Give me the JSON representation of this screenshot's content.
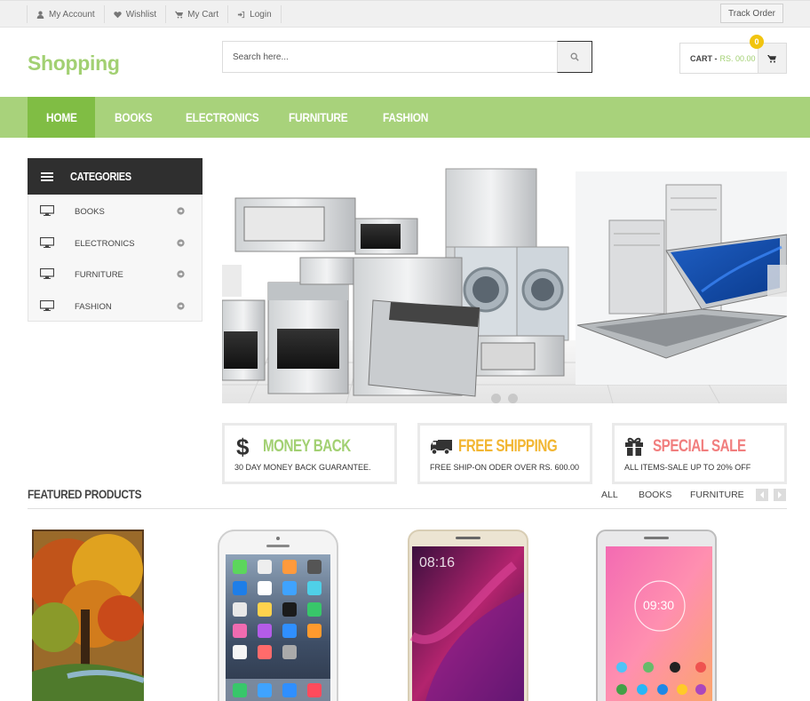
{
  "topbar": {
    "links": [
      {
        "label": "My Account",
        "icon": "user-icon"
      },
      {
        "label": "Wishlist",
        "icon": "heart-icon"
      },
      {
        "label": "My Cart",
        "icon": "cart-icon"
      },
      {
        "label": "Login",
        "icon": "login-icon"
      }
    ],
    "track_order": "Track Order"
  },
  "header": {
    "logo": "Shopping",
    "search_placeholder": "Search here...",
    "cart_label": "CART -",
    "cart_amount": "RS. 00.00",
    "cart_count": "0"
  },
  "nav": {
    "items": [
      "HOME",
      "BOOKS",
      "ELECTRONICS",
      "FURNITURE",
      "FASHION"
    ],
    "active": "HOME"
  },
  "categories": {
    "title": "CATEGORIES",
    "items": [
      "BOOKS",
      "ELECTRONICS",
      "FURNITURE",
      "FASHION"
    ]
  },
  "promos": [
    {
      "icon": "dollar-icon",
      "title": "MONEY BACK",
      "subtitle": "30 DAY MONEY BACK GUARANTEE.",
      "color": "#a2d072"
    },
    {
      "icon": "truck-icon",
      "title": "FREE SHIPPING",
      "subtitle": "FREE SHIP-ON ODER OVER RS. 600.00",
      "color": "#f2b632"
    },
    {
      "icon": "gift-icon",
      "title": "SPECIAL SALE",
      "subtitle": "ALL ITEMS-SALE UP TO 20% OFF",
      "color": "#f17e7e"
    }
  ],
  "featured": {
    "title": "FEATURED PRODUCTS",
    "filters": [
      "ALL",
      "BOOKS",
      "FURNITURE"
    ]
  },
  "colors": {
    "accent": "#a8d27b",
    "accent_dark": "#80bd44",
    "badge": "#f1c40f"
  }
}
